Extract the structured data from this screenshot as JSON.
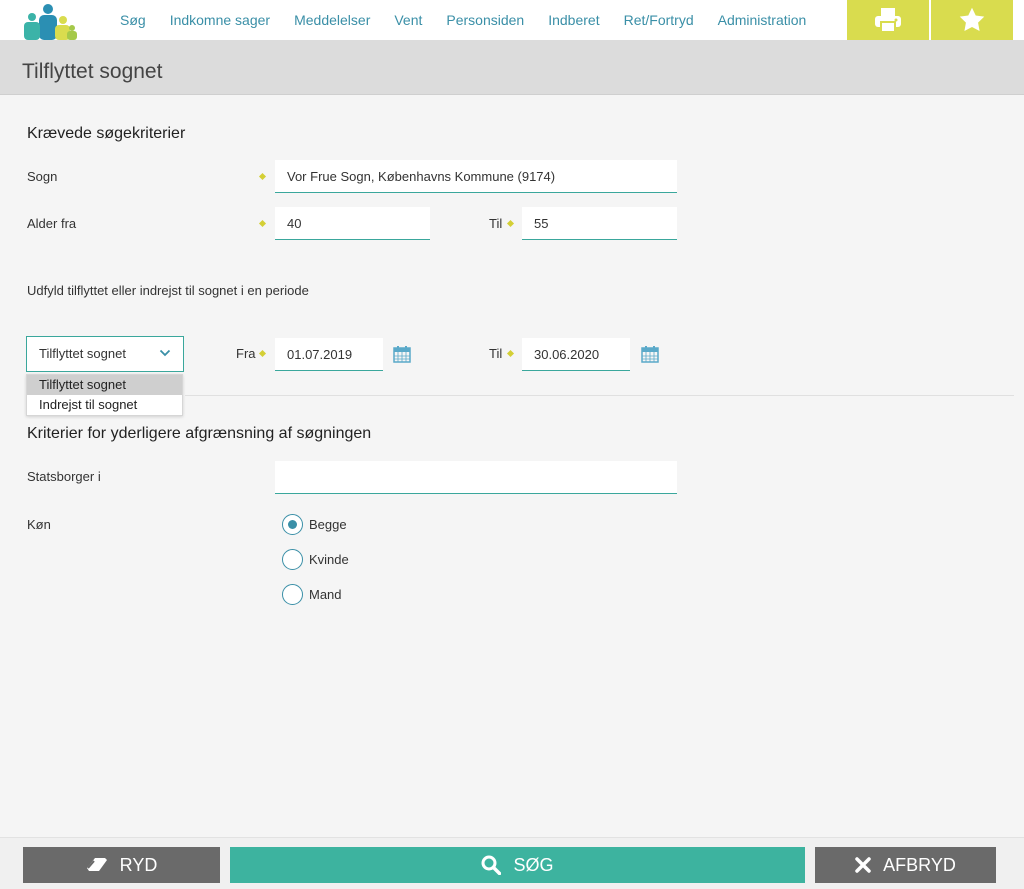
{
  "nav": {
    "items": [
      "Søg",
      "Indkomne sager",
      "Meddelelser",
      "Vent",
      "Personsiden",
      "Indberet",
      "Ret/Fortryd",
      "Administration"
    ]
  },
  "page": {
    "title": "Tilflyttet sognet"
  },
  "required": {
    "heading": "Krævede søgekriterier",
    "sogn_label": "Sogn",
    "sogn_value": "Vor Frue Sogn, Københavns Kommune (9174)",
    "alder_label": "Alder fra",
    "alder_fra_value": "40",
    "til_label": "Til",
    "alder_til_value": "55",
    "period_hint": "Udfyld tilflyttet eller indrejst til sognet i en periode",
    "period_select": {
      "value": "Tilflyttet sognet",
      "options": [
        "Tilflyttet sognet",
        "Indrejst til sognet"
      ]
    },
    "fra_label": "Fra",
    "fra_value": "01.07.2019",
    "til2_label": "Til",
    "til2_value": "30.06.2020"
  },
  "optional": {
    "heading": "Kriterier for yderligere afgrænsning af søgningen",
    "statsborger_label": "Statsborger i",
    "statsborger_value": "",
    "kon_label": "Køn",
    "kon_options": [
      "Begge",
      "Kvinde",
      "Mand"
    ],
    "kon_selected": "Begge"
  },
  "actions": {
    "clear": "RYD",
    "search": "SØG",
    "cancel": "AFBRYD"
  },
  "colors": {
    "accent": "#3aa79c",
    "nav_text": "#3a8fa7",
    "tool_bg": "#d9dc4e",
    "search_btn": "#3db39f",
    "grey_btn": "#6a6a6a"
  },
  "icons": [
    "logo-people-icon",
    "printer-icon",
    "star-icon",
    "chevron-down-icon",
    "calendar-icon",
    "eraser-icon",
    "search-icon",
    "close-icon"
  ]
}
